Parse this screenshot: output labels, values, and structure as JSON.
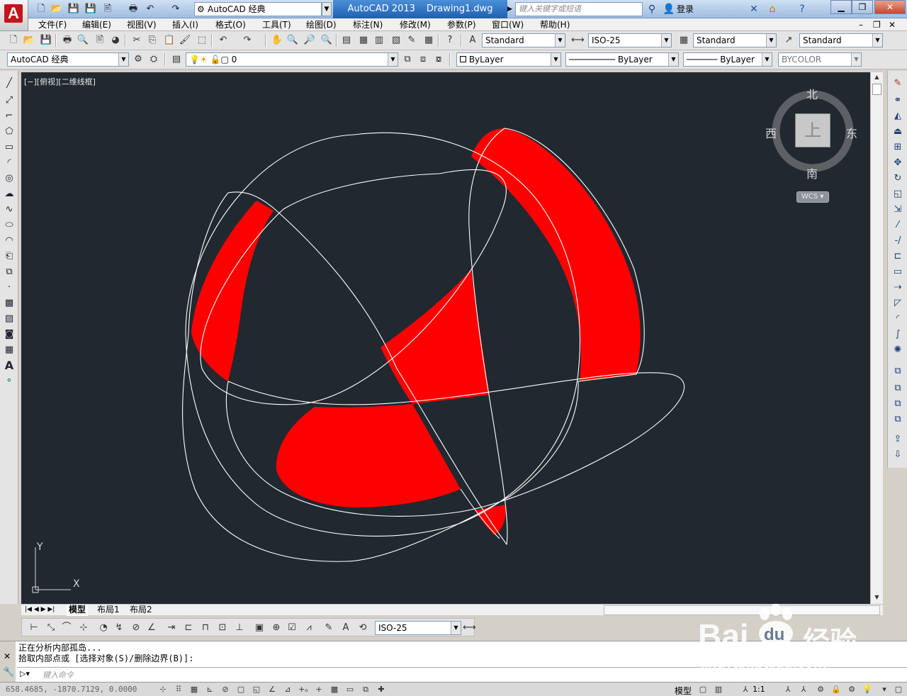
{
  "title_bar": {
    "workspace": "AutoCAD 经典",
    "app_name": "AutoCAD 2013",
    "file_name": "Drawing1.dwg",
    "search_placeholder": "键入关键字或短语",
    "login_label": "登录"
  },
  "menu": [
    "文件(F)",
    "编辑(E)",
    "视图(V)",
    "插入(I)",
    "格式(O)",
    "工具(T)",
    "绘图(D)",
    "标注(N)",
    "修改(M)",
    "参数(P)",
    "窗口(W)",
    "帮助(H)"
  ],
  "styles_toolbar": {
    "text_style": "Standard",
    "dim_style": "ISO-25",
    "table_style": "Standard",
    "multileader_style": "Standard"
  },
  "layers_toolbar": {
    "workspace": "AutoCAD 经典",
    "layer": "0",
    "color": "ByLayer",
    "linetype": "ByLayer",
    "lineweight": "ByLayer",
    "plotstyle": "BYCOLOR"
  },
  "viewport": {
    "label": "[−][俯视][二维线框]",
    "viewcube": {
      "north": "北",
      "south": "南",
      "east": "东",
      "west": "西",
      "top": "上",
      "wcs": "WCS"
    },
    "ucs": {
      "x": "X",
      "y": "Y"
    }
  },
  "layout_tabs": [
    "模型",
    "布局1",
    "布局2"
  ],
  "dim_toolbar": {
    "dim_style": "ISO-25"
  },
  "command": {
    "line1": "正在分析内部孤岛...",
    "line2": "拾取内部点或 [选择对象(S)/删除边界(B)]:",
    "placeholder": "键入命令"
  },
  "status": {
    "coords": "658.4685,  -1870.7129, 0.0000",
    "model": "模型",
    "scale": "1:1"
  },
  "watermark": {
    "brand": "Bai",
    "brand2": "du",
    "cn": "经验",
    "url": "jingyan.baidu.com"
  },
  "colors": {
    "canvas": "#212830",
    "hatch": "#ff0000",
    "curve": "#ffffff",
    "title_blue": "#2b6fc6"
  }
}
